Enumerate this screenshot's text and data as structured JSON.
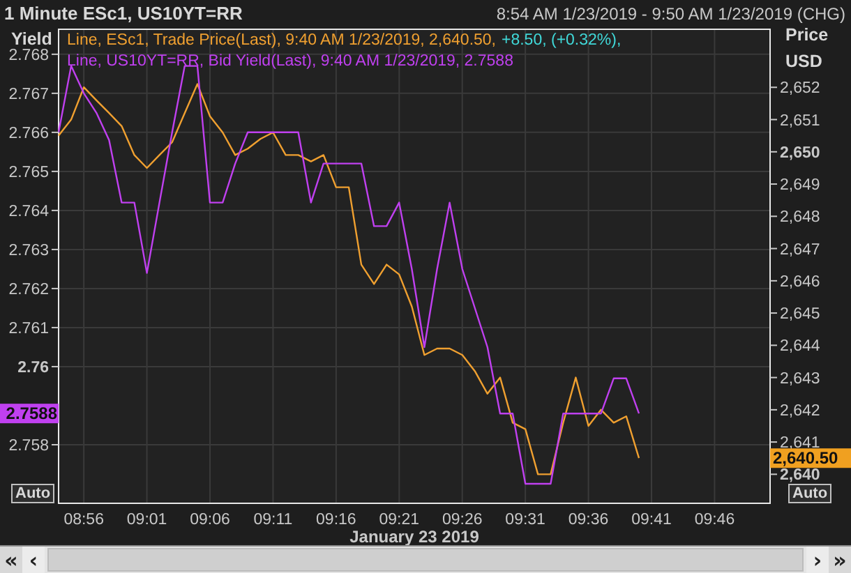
{
  "header": {
    "title": "1 Minute ESc1, US10YT=RR",
    "range": "8:54 AM 1/23/2019 - 9:50 AM 1/23/2019 (CHG)"
  },
  "legend": [
    {
      "parts": [
        {
          "text": "Line, ESc1, Trade Price(Last), 9:40 AM 1/23/2019, 2,640.50,",
          "color": "#f0a030"
        },
        {
          "text": "+8.50, (+0.32%),",
          "color": "#40d8d8"
        }
      ]
    },
    {
      "parts": [
        {
          "text": "Line, US10YT=RR, Bid Yield(Last), 9:40 AM 1/23/2019, 2.7588",
          "color": "#c040f0"
        }
      ]
    }
  ],
  "chart_data": {
    "type": "line",
    "xlabel": "January 23 2019",
    "ylabel": "Yield",
    "y2label": "Price USD",
    "x": [
      534,
      535,
      536,
      537,
      538,
      539,
      540,
      541,
      542,
      543,
      544,
      545,
      546,
      547,
      548,
      549,
      550,
      551,
      552,
      553,
      554,
      555,
      556,
      557,
      558,
      559,
      560,
      561,
      562,
      563,
      564,
      565,
      566,
      567,
      568,
      569,
      570,
      571,
      572,
      573,
      574,
      575,
      576,
      577,
      578,
      579,
      580
    ],
    "series": [
      {
        "color": "#f0a030",
        "axis": "y2",
        "values": [
          2650.5,
          2651.0,
          2652.0,
          2651.6,
          2651.2,
          2650.8,
          2649.9,
          2649.5,
          2649.9,
          2650.3,
          2651.2,
          2652.1,
          2651.1,
          2650.6,
          2649.9,
          2650.1,
          2650.4,
          2650.6,
          2649.9,
          2649.9,
          2649.7,
          2649.9,
          2648.9,
          2648.9,
          2646.5,
          2645.9,
          2646.5,
          2646.2,
          2645.2,
          2643.7,
          2643.9,
          2643.9,
          2643.7,
          2643.2,
          2642.5,
          2643.0,
          2641.6,
          2641.4,
          2640.0,
          2640.0,
          2641.6,
          2643.0,
          2641.5,
          2642.0,
          2641.6,
          2641.8,
          2640.5
        ]
      },
      {
        "color": "#c040f0",
        "values": [
          2.766,
          2.7677,
          2.767,
          2.7665,
          2.7658,
          2.7642,
          2.7642,
          2.7624,
          2.7642,
          2.766,
          2.7677,
          2.7677,
          2.7642,
          2.7642,
          2.7652,
          2.766,
          2.766,
          2.766,
          2.766,
          2.766,
          2.7642,
          2.7652,
          2.7652,
          2.7652,
          2.7652,
          2.7636,
          2.7636,
          2.7642,
          2.7625,
          2.7605,
          2.7625,
          2.7642,
          2.7625,
          2.7615,
          2.7605,
          2.7588,
          2.7588,
          2.757,
          2.757,
          2.757,
          2.7588,
          2.7588,
          2.7588,
          2.7588,
          2.7597,
          2.7597,
          2.7588
        ]
      }
    ],
    "grid": true,
    "xlim": [
      534,
      590.4
    ],
    "ylim": [
      2.7565,
      2.76864
    ],
    "y2lim": [
      2639.1,
      2653.8
    ],
    "xticks": [
      {
        "value": 536,
        "label": "08:56"
      },
      {
        "value": 541,
        "label": "09:01"
      },
      {
        "value": 546,
        "label": "09:06"
      },
      {
        "value": 551,
        "label": "09:11"
      },
      {
        "value": 556,
        "label": "09:16"
      },
      {
        "value": 561,
        "label": "09:21"
      },
      {
        "value": 566,
        "label": "09:26"
      },
      {
        "value": 571,
        "label": "09:31"
      },
      {
        "value": 576,
        "label": "09:36"
      },
      {
        "value": 581,
        "label": "09:41"
      },
      {
        "value": 586,
        "label": "09:46"
      }
    ],
    "yticks": [
      {
        "value": 2.768,
        "label": "2.768"
      },
      {
        "value": 2.767,
        "label": "2.767"
      },
      {
        "value": 2.766,
        "label": "2.766"
      },
      {
        "value": 2.765,
        "label": "2.765"
      },
      {
        "value": 2.764,
        "label": "2.764"
      },
      {
        "value": 2.763,
        "label": "2.763"
      },
      {
        "value": 2.762,
        "label": "2.762"
      },
      {
        "value": 2.761,
        "label": "2.761"
      },
      {
        "value": 2.76,
        "label": "2.76"
      },
      {
        "value": 2.758,
        "label": "2.758"
      }
    ],
    "y2ticks": [
      {
        "value": 2652,
        "label": "2,652"
      },
      {
        "value": 2651,
        "label": "2,651"
      },
      {
        "value": 2650,
        "label": "2,650"
      },
      {
        "value": 2649,
        "label": "2,649"
      },
      {
        "value": 2648,
        "label": "2,648"
      },
      {
        "value": 2647,
        "label": "2,647"
      },
      {
        "value": 2646,
        "label": "2,646"
      },
      {
        "value": 2645,
        "label": "2,645"
      },
      {
        "value": 2644,
        "label": "2,644"
      },
      {
        "value": 2643,
        "label": "2,643"
      },
      {
        "value": 2642,
        "label": "2,642"
      },
      {
        "value": 2641,
        "label": "2,641"
      },
      {
        "value": 2640,
        "label": "2,640"
      }
    ]
  },
  "value_tags": [
    {
      "text": "2.7588",
      "kind": "left",
      "color": "#c040f0"
    },
    {
      "text": "2,640.50",
      "kind": "right",
      "color": "#f0a020"
    }
  ],
  "auto_buttons": [
    "Auto",
    "Auto"
  ],
  "scrollbar": {
    "buttons": [
      "«",
      "‹",
      "›",
      "»"
    ]
  }
}
